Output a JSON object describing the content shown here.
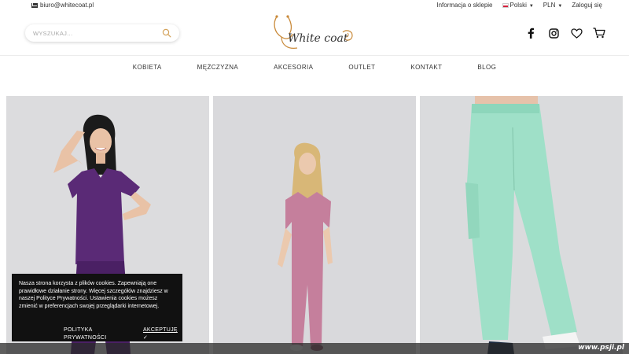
{
  "topbar": {
    "email": "biuro@whitecoat.pl",
    "info_link": "Informacja o sklepie",
    "language": "Polski",
    "currency": "PLN",
    "login": "Zaloguj się"
  },
  "header": {
    "search_placeholder": "WYSZUKAJ...",
    "logo_text": "White coat",
    "icons": [
      "facebook-icon",
      "instagram-icon",
      "heart-icon",
      "cart-icon"
    ]
  },
  "nav": {
    "items": [
      "KOBIETA",
      "MĘŻCZYZNA",
      "AKCESORIA",
      "OUTLET",
      "KONTAKT",
      "BLOG"
    ]
  },
  "products": {
    "cards": [
      {
        "scrub_color": "#5a2a76"
      },
      {
        "scrub_color": "#c57f9c"
      },
      {
        "scrub_color": "#9fe0c8"
      }
    ]
  },
  "cookie": {
    "text": "Nasza strona korzysta z plików cookies. Zapewniają one prawidłowe działanie strony. Więcej szczegółów znajdziesz w naszej Polityce Prywatności. Ustawienia cookies możesz zmienić w preferencjach swojej przeglądarki internetowej.",
    "privacy_label": "POLITYKA PRYWATNOŚCI",
    "accept_label": "AKCEPTUJĘ"
  },
  "watermark": "www.psji.pl",
  "colors": {
    "logo_gold": "#c98a3a",
    "search_icon": "#d4a35c",
    "card_bg": "#d9dadc"
  }
}
